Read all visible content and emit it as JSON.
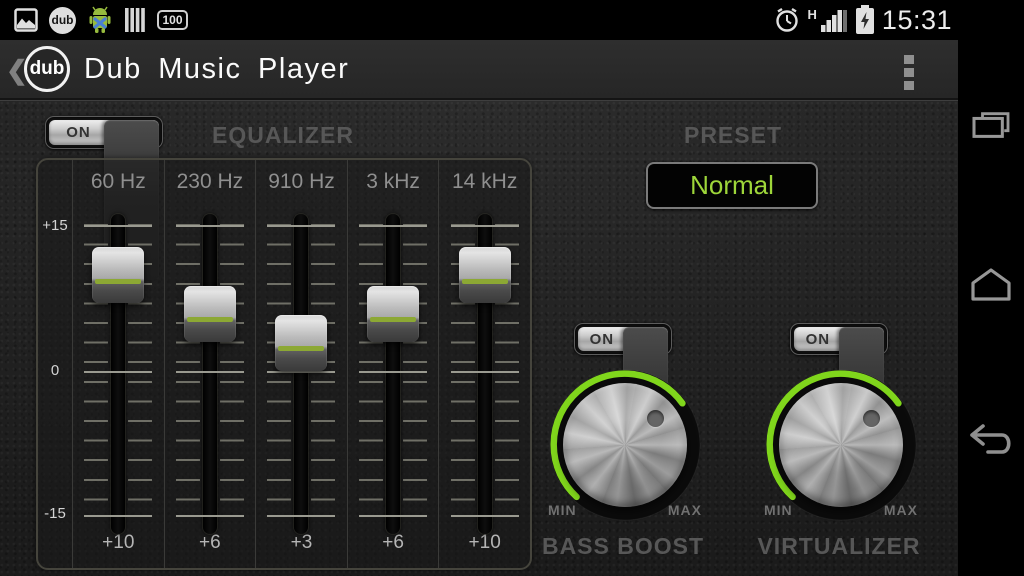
{
  "status_bar": {
    "time": "15:31",
    "battery_badge": "100",
    "network_type": "H",
    "left_icons": [
      "picture-icon",
      "dub-notification-icon",
      "android-icon",
      "equalizer-bars-icon",
      "battery-level-badge"
    ],
    "right_icons": [
      "alarm-icon",
      "signal-strength-icon",
      "battery-charging-icon"
    ]
  },
  "app_bar": {
    "back_glyph": "❮",
    "logo_text": "dub",
    "title": "Dub Music Player",
    "menu_icon": "overflow-menu-icon"
  },
  "nav_bar": {
    "icons": [
      "recents-icon",
      "home-icon",
      "back-icon"
    ]
  },
  "equalizer": {
    "section_label": "EQUALIZER",
    "toggle_label": "ON",
    "enabled": true,
    "scale": {
      "max_label": "+15",
      "mid_label": "0",
      "min_label": "-15",
      "max": 15,
      "min": -15
    },
    "bands": [
      {
        "freq": "60 Hz",
        "value": 10,
        "value_label": "+10"
      },
      {
        "freq": "230 Hz",
        "value": 6,
        "value_label": "+6"
      },
      {
        "freq": "910 Hz",
        "value": 3,
        "value_label": "+3"
      },
      {
        "freq": "3 kHz",
        "value": 6,
        "value_label": "+6"
      },
      {
        "freq": "14 kHz",
        "value": 10,
        "value_label": "+10"
      }
    ]
  },
  "preset": {
    "section_label": "PRESET",
    "selected": "Normal"
  },
  "bass_boost": {
    "label": "BASS BOOST",
    "toggle_label": "ON",
    "enabled": true,
    "min_label": "MIN",
    "max_label": "MAX"
  },
  "virtualizer": {
    "label": "VIRTUALIZER",
    "toggle_label": "ON",
    "enabled": true,
    "min_label": "MIN",
    "max_label": "MAX"
  },
  "colors": {
    "accent_green": "#80d61c",
    "preset_green": "#9ed63a",
    "slider_line_green": "#8ca834"
  }
}
